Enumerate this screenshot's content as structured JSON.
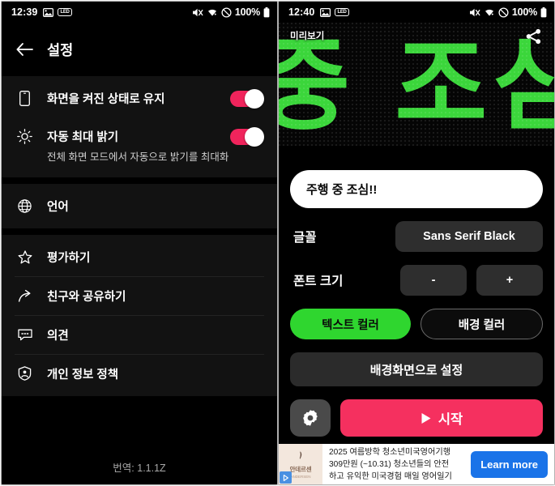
{
  "settings_screen": {
    "status_bar": {
      "time": "12:39",
      "battery_percent": "100%",
      "icons": [
        "image-icon",
        "led-badge-icon",
        "mute-icon",
        "wifi-icon",
        "do-not-disturb-icon",
        "battery-icon"
      ]
    },
    "appbar": {
      "back_icon": "back-arrow-icon",
      "title": "설정"
    },
    "group1": [
      {
        "icon": "screen-icon",
        "label": "화면을 켜진 상태로 유지",
        "toggle": "on",
        "sub": ""
      },
      {
        "icon": "brightness-icon",
        "label": "자동 최대 밝기",
        "toggle": "on",
        "sub": "전체 화면 모드에서 자동으로 밝기를 최대화"
      }
    ],
    "group2": [
      {
        "icon": "globe-icon",
        "label": "언어"
      }
    ],
    "group3": [
      {
        "icon": "star-icon",
        "label": "평가하기"
      },
      {
        "icon": "share-arrow-icon",
        "label": "친구와 공유하기"
      },
      {
        "icon": "feedback-icon",
        "label": "의견"
      },
      {
        "icon": "privacy-shield-icon",
        "label": "개인 정보 정책"
      }
    ],
    "version": "번역: 1.1.1Z"
  },
  "banner_screen": {
    "status_bar": {
      "time": "12:40",
      "battery_percent": "100%",
      "icons": [
        "image-icon",
        "led-badge-icon",
        "mute-icon",
        "wifi-icon",
        "do-not-disturb-icon",
        "battery-icon"
      ]
    },
    "preview": {
      "label": "미리보기",
      "share_icon": "share-icon",
      "marquee_text": "중 조심!",
      "text_color": "#3bd63b",
      "background_color": "#050505"
    },
    "text_input": {
      "value": "주행 중 조심!!",
      "placeholder": "주행 중 조심!!"
    },
    "font_row": {
      "label": "글꼴",
      "value": "Sans Serif Black"
    },
    "font_size_row": {
      "label": "폰트 크기",
      "decrease": "-",
      "increase": "+"
    },
    "color_buttons": {
      "text_color": "텍스트 컬러",
      "text_color_swatch": "#2fd62f",
      "background_color": "배경 컬러",
      "background_color_swatch": "#0c0c0c"
    },
    "wallpaper_button": "배경화면으로 설정",
    "settings_button_icon": "gear-icon",
    "start_button": {
      "label": "시작",
      "play_icon": "play-icon",
      "color": "#f5305f"
    },
    "ad": {
      "brand": "안데르센",
      "brand_sub": "ANDERSEN",
      "adchoices_icon": "adchoices-icon",
      "line1": "2025 여름방학 청소년미국영어기행",
      "line2": "309만원 (~10.31) 청소년들의 안전",
      "line3": "하고 유익한 미국경험 매일 영어일기",
      "cta": "Learn more",
      "cta_color": "#1a73e8"
    }
  }
}
